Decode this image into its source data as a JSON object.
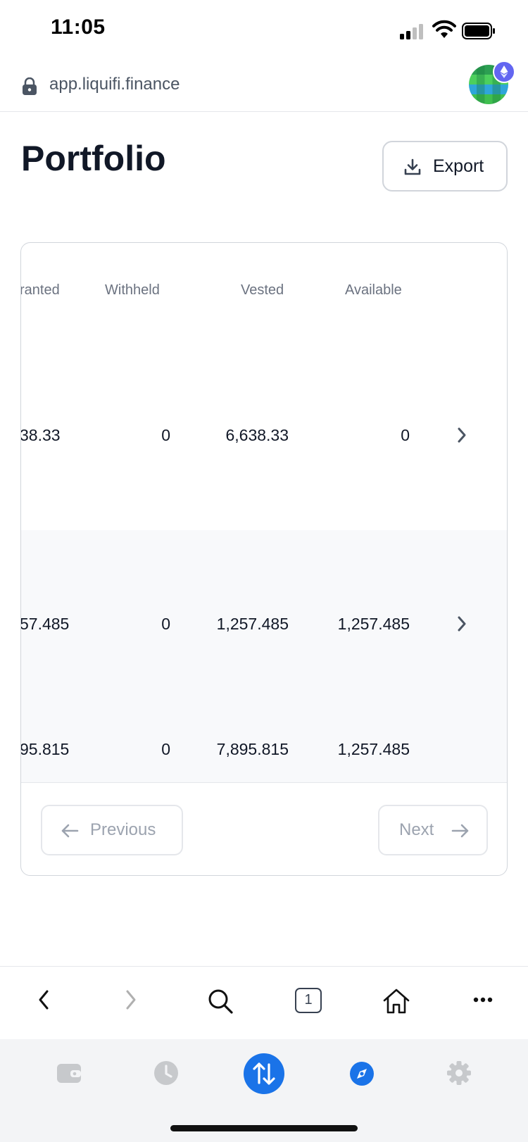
{
  "status_bar": {
    "time": "11:05"
  },
  "browser": {
    "url": "app.liquifi.finance",
    "tab_count": "1"
  },
  "header": {
    "title": "Portfolio",
    "export_label": "Export"
  },
  "table": {
    "columns": [
      "ranted",
      "Withheld",
      "Vested",
      "Available"
    ],
    "rows": [
      {
        "granted": "38.33",
        "withheld": "0",
        "vested": "6,638.33",
        "available": "0"
      },
      {
        "granted": "57.485",
        "withheld": "0",
        "vested": "1,257.485",
        "available": "1,257.485"
      }
    ],
    "total": {
      "granted": "95.815",
      "withheld": "0",
      "vested": "7,895.815",
      "available": "1,257.485"
    }
  },
  "pagination": {
    "previous_label": "Previous",
    "next_label": "Next"
  },
  "colors": {
    "accent": "#1a73e8",
    "tab_inactive": "#c7c9cc",
    "text": "#111827",
    "muted": "#6b7280"
  }
}
